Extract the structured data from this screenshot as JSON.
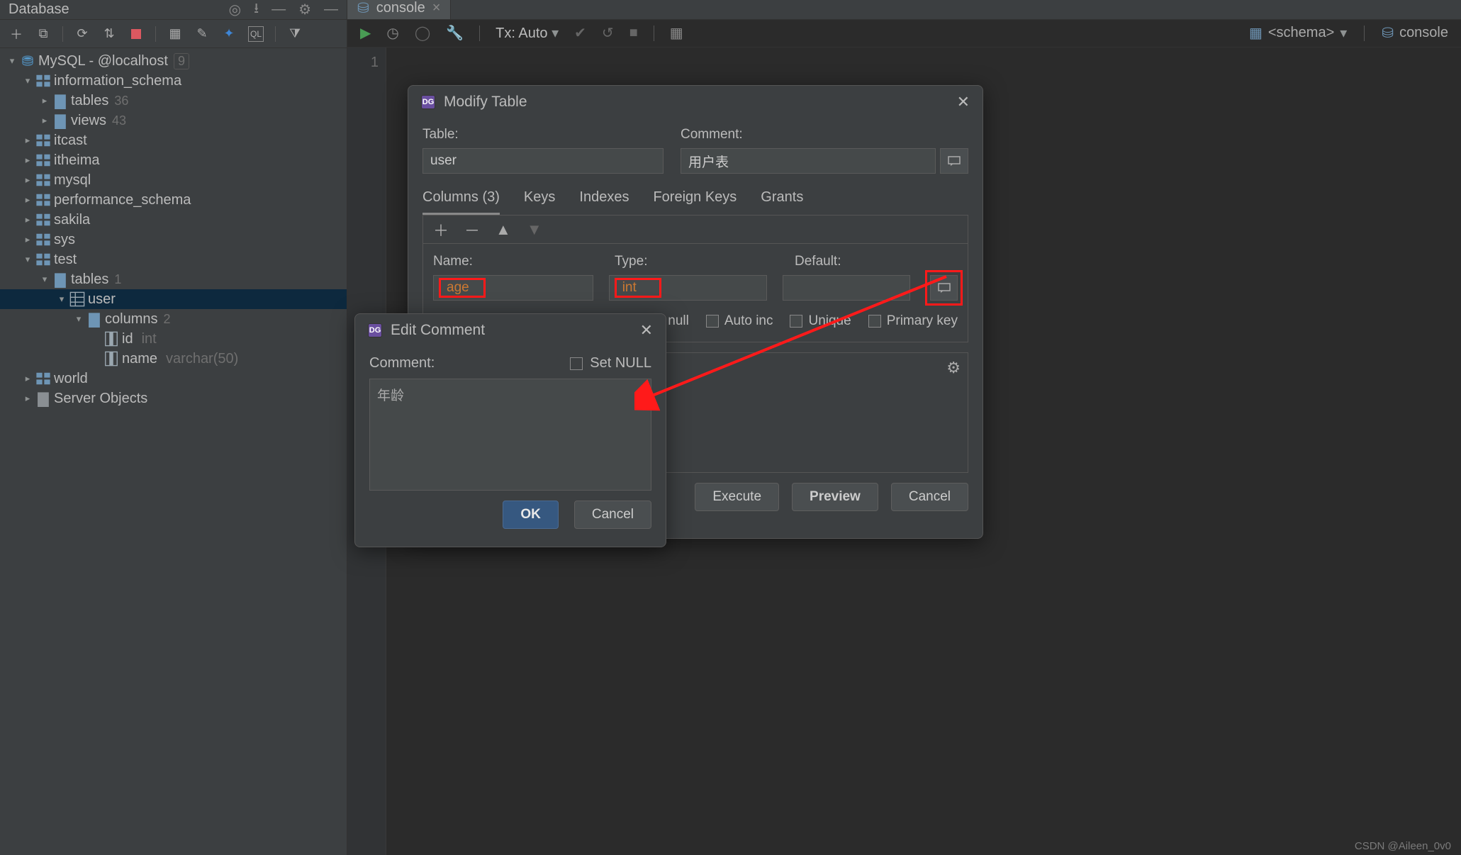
{
  "app": {
    "panel_title": "Database",
    "tab": "console",
    "tx_label": "Tx: Auto",
    "schema_selector": "<schema>",
    "console_label": "console"
  },
  "gutter": {
    "line": "1"
  },
  "tree": {
    "root_label": "MySQL - @localhost",
    "root_badge": "9",
    "info_schema": "information_schema",
    "tables_label": "tables",
    "tables_badge": "36",
    "views_label": "views",
    "views_badge": "43",
    "itcast": "itcast",
    "itheima": "itheima",
    "mysql": "mysql",
    "perf": "performance_schema",
    "sakila": "sakila",
    "sys": "sys",
    "test": "test",
    "test_tables": "tables",
    "test_tables_badge": "1",
    "user": "user",
    "columns": "columns",
    "columns_badge": "2",
    "id": "id",
    "id_type": "int",
    "name": "name",
    "name_type": "varchar(50)",
    "world": "world",
    "server_objects": "Server Objects"
  },
  "modify": {
    "title": "Modify Table",
    "table_label": "Table:",
    "table_value": "user",
    "comment_label": "Comment:",
    "comment_value": "用户表",
    "tabs": {
      "columns": "Columns (3)",
      "keys": "Keys",
      "indexes": "Indexes",
      "fk": "Foreign Keys",
      "grants": "Grants"
    },
    "col_name_label": "Name:",
    "col_type_label": "Type:",
    "col_default_label": "Default:",
    "col_name_value": "age",
    "col_type_value": "int",
    "col_default_value": "",
    "chk": {
      "notnull": "Not null",
      "auto": "Auto inc",
      "unique": "Unique",
      "pk": "Primary key"
    },
    "actions": {
      "execute": "Execute",
      "preview": "Preview",
      "cancel": "Cancel"
    }
  },
  "edit_comment": {
    "title": "Edit Comment",
    "label": "Comment:",
    "setnull": "Set NULL",
    "value": "年龄",
    "ok": "OK",
    "cancel": "Cancel"
  },
  "watermark": "CSDN @Aileen_0v0"
}
